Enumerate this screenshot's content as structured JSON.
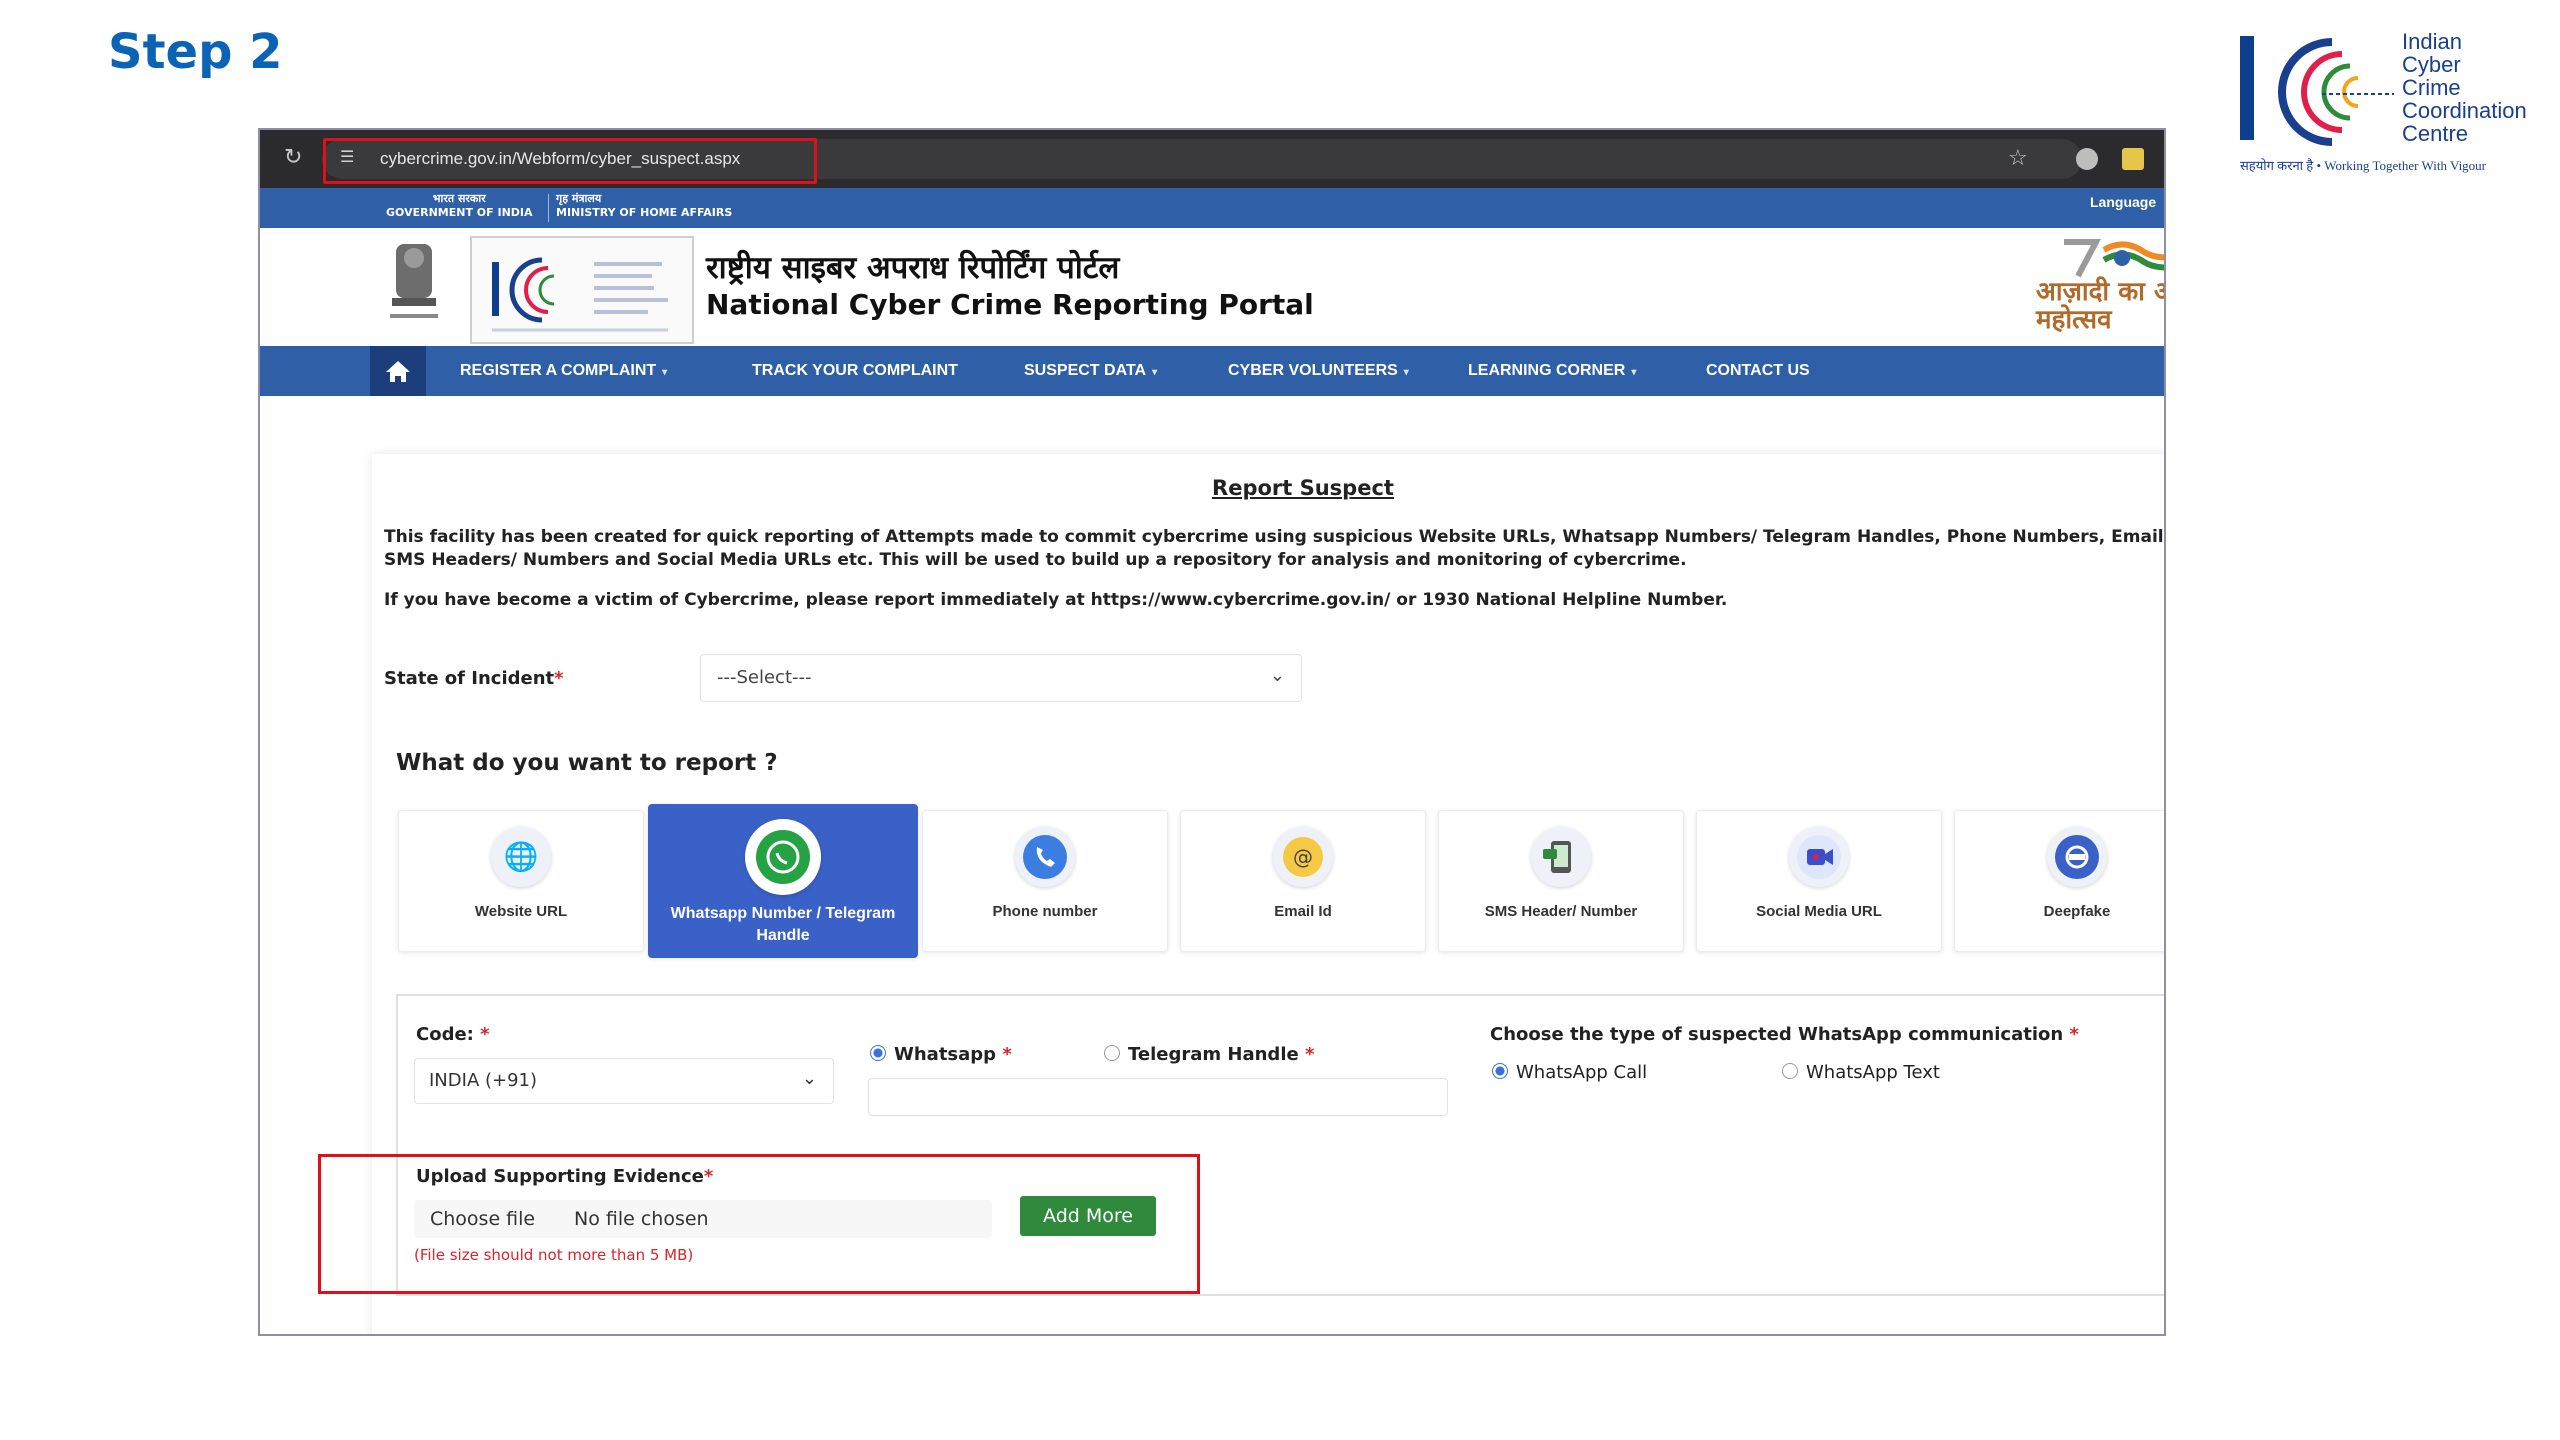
{
  "step_title": "Step 2",
  "i4c_logo": {
    "words": [
      "Indian",
      "Cyber",
      "Crime",
      "Coordination",
      "Centre"
    ],
    "tagline": "सहयोग करना है • Working Together With Vigour"
  },
  "browser": {
    "url": "cybercrime.gov.in/Webform/cyber_suspect.aspx",
    "icons": [
      "reload-icon",
      "site-settings-icon",
      "star-icon"
    ]
  },
  "gov_strip": {
    "left_hindi": "भारत सरकार",
    "left_english": "GOVERNMENT OF INDIA",
    "right_hindi": "गृह मंत्रालय",
    "right_english": "MINISTRY OF HOME AFFAIRS",
    "language_label": "Language"
  },
  "header": {
    "title_hindi": "राष्ट्रीय साइबर अपराध रिपोर्टिंग पोर्टल",
    "title_english": "National Cyber Crime Reporting Portal",
    "azadi_hindi": "आज़ादी का अमृत महोत्सव"
  },
  "nav": {
    "items": [
      {
        "label": "REGISTER A COMPLAINT",
        "dropdown": true
      },
      {
        "label": "TRACK YOUR COMPLAINT",
        "dropdown": false
      },
      {
        "label": "SUSPECT DATA",
        "dropdown": true
      },
      {
        "label": "CYBER VOLUNTEERS",
        "dropdown": true
      },
      {
        "label": "LEARNING CORNER",
        "dropdown": true
      },
      {
        "label": "CONTACT US",
        "dropdown": false
      }
    ]
  },
  "main": {
    "title": "Report Suspect",
    "description": "This facility has been created for quick reporting of Attempts made to commit cybercrime using suspicious Website URLs, Whatsapp Numbers/ Telegram Handles, Phone Numbers, Email-IDs, SMS Headers/ Numbers and Social Media URLs etc. This will be used to build up a repository for analysis and monitoring of cybercrime.",
    "victim_note": "If you have become a victim of Cybercrime, please report immediately at https://www.cybercrime.gov.in/ or 1930 National Helpline Number.",
    "state_label": "State of Incident",
    "state_value": "---Select---",
    "what_title": "What do you want to report ?",
    "report_types": [
      {
        "label": "Website URL",
        "icon": "globe-icon",
        "active": false
      },
      {
        "label": "Whatsapp Number / Telegram Handle",
        "icon": "whatsapp-icon",
        "active": true
      },
      {
        "label": "Phone number",
        "icon": "phone-icon",
        "active": false
      },
      {
        "label": "Email Id",
        "icon": "email-icon",
        "active": false
      },
      {
        "label": "SMS Header/ Number",
        "icon": "sms-icon",
        "active": false
      },
      {
        "label": "Social Media URL",
        "icon": "video-camera-icon",
        "active": false
      },
      {
        "label": "Deepfake",
        "icon": "deepfake-icon",
        "active": false
      }
    ],
    "form": {
      "code_label": "Code:",
      "code_value": "INDIA (+91)",
      "radio_whatsapp": "Whatsapp",
      "radio_telegram": "Telegram Handle",
      "selected_channel": "Whatsapp",
      "wa_type_label": "Choose the type of suspected WhatsApp communication",
      "wa_call": "WhatsApp Call",
      "wa_text": "WhatsApp Text",
      "selected_wa_type": "WhatsApp Call",
      "upload_label": "Upload Supporting Evidence",
      "choose_file": "Choose file",
      "no_file": "No file chosen",
      "add_more": "Add More",
      "size_note": "(File size should not more than 5 MB)"
    }
  },
  "colors": {
    "accent_blue": "#2f5fa6",
    "active_card": "#3a61c7",
    "highlight_red": "#e0101a",
    "add_more_green": "#2f8a3c",
    "step_blue": "#0b63b6"
  }
}
